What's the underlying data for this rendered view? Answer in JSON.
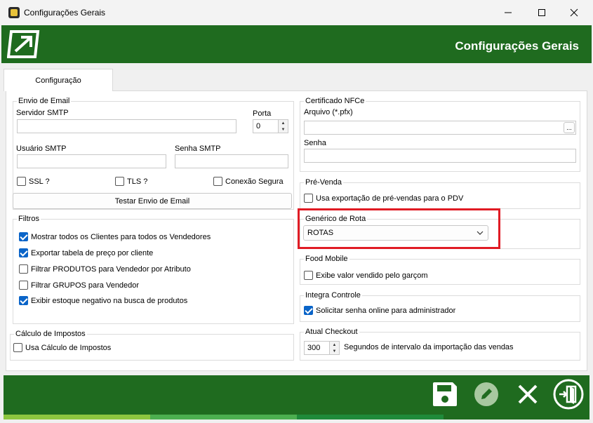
{
  "window": {
    "title": "Configurações Gerais",
    "minimize": "—",
    "maximize": "☐",
    "close": "✕"
  },
  "header": {
    "title": "Configurações Gerais"
  },
  "tabs": [
    {
      "label": "Configuração"
    }
  ],
  "email": {
    "group_label": "Envio de Email",
    "smtp_server_label": "Servidor SMTP",
    "smtp_server_value": "",
    "port_label": "Porta",
    "port_value": "0",
    "user_label": "Usuário SMTP",
    "user_value": "",
    "password_label": "Senha SMTP",
    "password_value": "",
    "ssl_label": "SSL ?",
    "ssl_checked": false,
    "tls_label": "TLS ?",
    "tls_checked": false,
    "secure_label": "Conexão Segura",
    "secure_checked": false,
    "test_button": "Testar Envio de Email"
  },
  "filters": {
    "group_label": "Filtros",
    "items": [
      {
        "label": "Mostrar todos os Clientes para todos os Vendedores",
        "checked": true
      },
      {
        "label": "Exportar tabela de preço por cliente",
        "checked": true
      },
      {
        "label": "Filtrar PRODUTOS para Vendedor por Atributo",
        "checked": false
      },
      {
        "label": "Filtrar GRUPOS para Vendedor",
        "checked": false
      },
      {
        "label": "Exibir estoque negativo na busca de produtos",
        "checked": true
      }
    ]
  },
  "taxes": {
    "group_label": "Cálculo de Impostos",
    "checkbox_label": "Usa Cálculo de Impostos",
    "checked": false
  },
  "nfce": {
    "group_label": "Certificado NFCe",
    "file_label": "Arquivo (*.pfx)",
    "file_value": "",
    "browse_button": "...",
    "password_label": "Senha",
    "password_value": ""
  },
  "presale": {
    "group_label": "Pré-Venda",
    "checkbox_label": "Usa exportação de pré-vendas para o PDV",
    "checked": false
  },
  "route": {
    "group_label": "Genérico de Rota",
    "selected": "ROTAS"
  },
  "food": {
    "group_label": "Food Mobile",
    "checkbox_label": "Exibe valor vendido pelo garçom",
    "checked": false
  },
  "integra": {
    "group_label": "Integra Controle",
    "checkbox_label": "Solicitar senha online para administrador",
    "checked": true
  },
  "checkout": {
    "group_label": "Atual Checkout",
    "interval_value": "300",
    "interval_label": "Segundos de intervalo da importação das vendas"
  },
  "footer": {
    "icons": [
      "save-icon",
      "edit-icon",
      "cancel-icon",
      "exit-icon"
    ]
  },
  "colors": {
    "header_green": "#1f6b1f",
    "checkbox_blue": "#0a64c8",
    "highlight_red": "#e01b24",
    "stripe_light": "#8dc63f",
    "stripe_mid": "#4caf50",
    "stripe_dark": "#1f8a3a"
  }
}
